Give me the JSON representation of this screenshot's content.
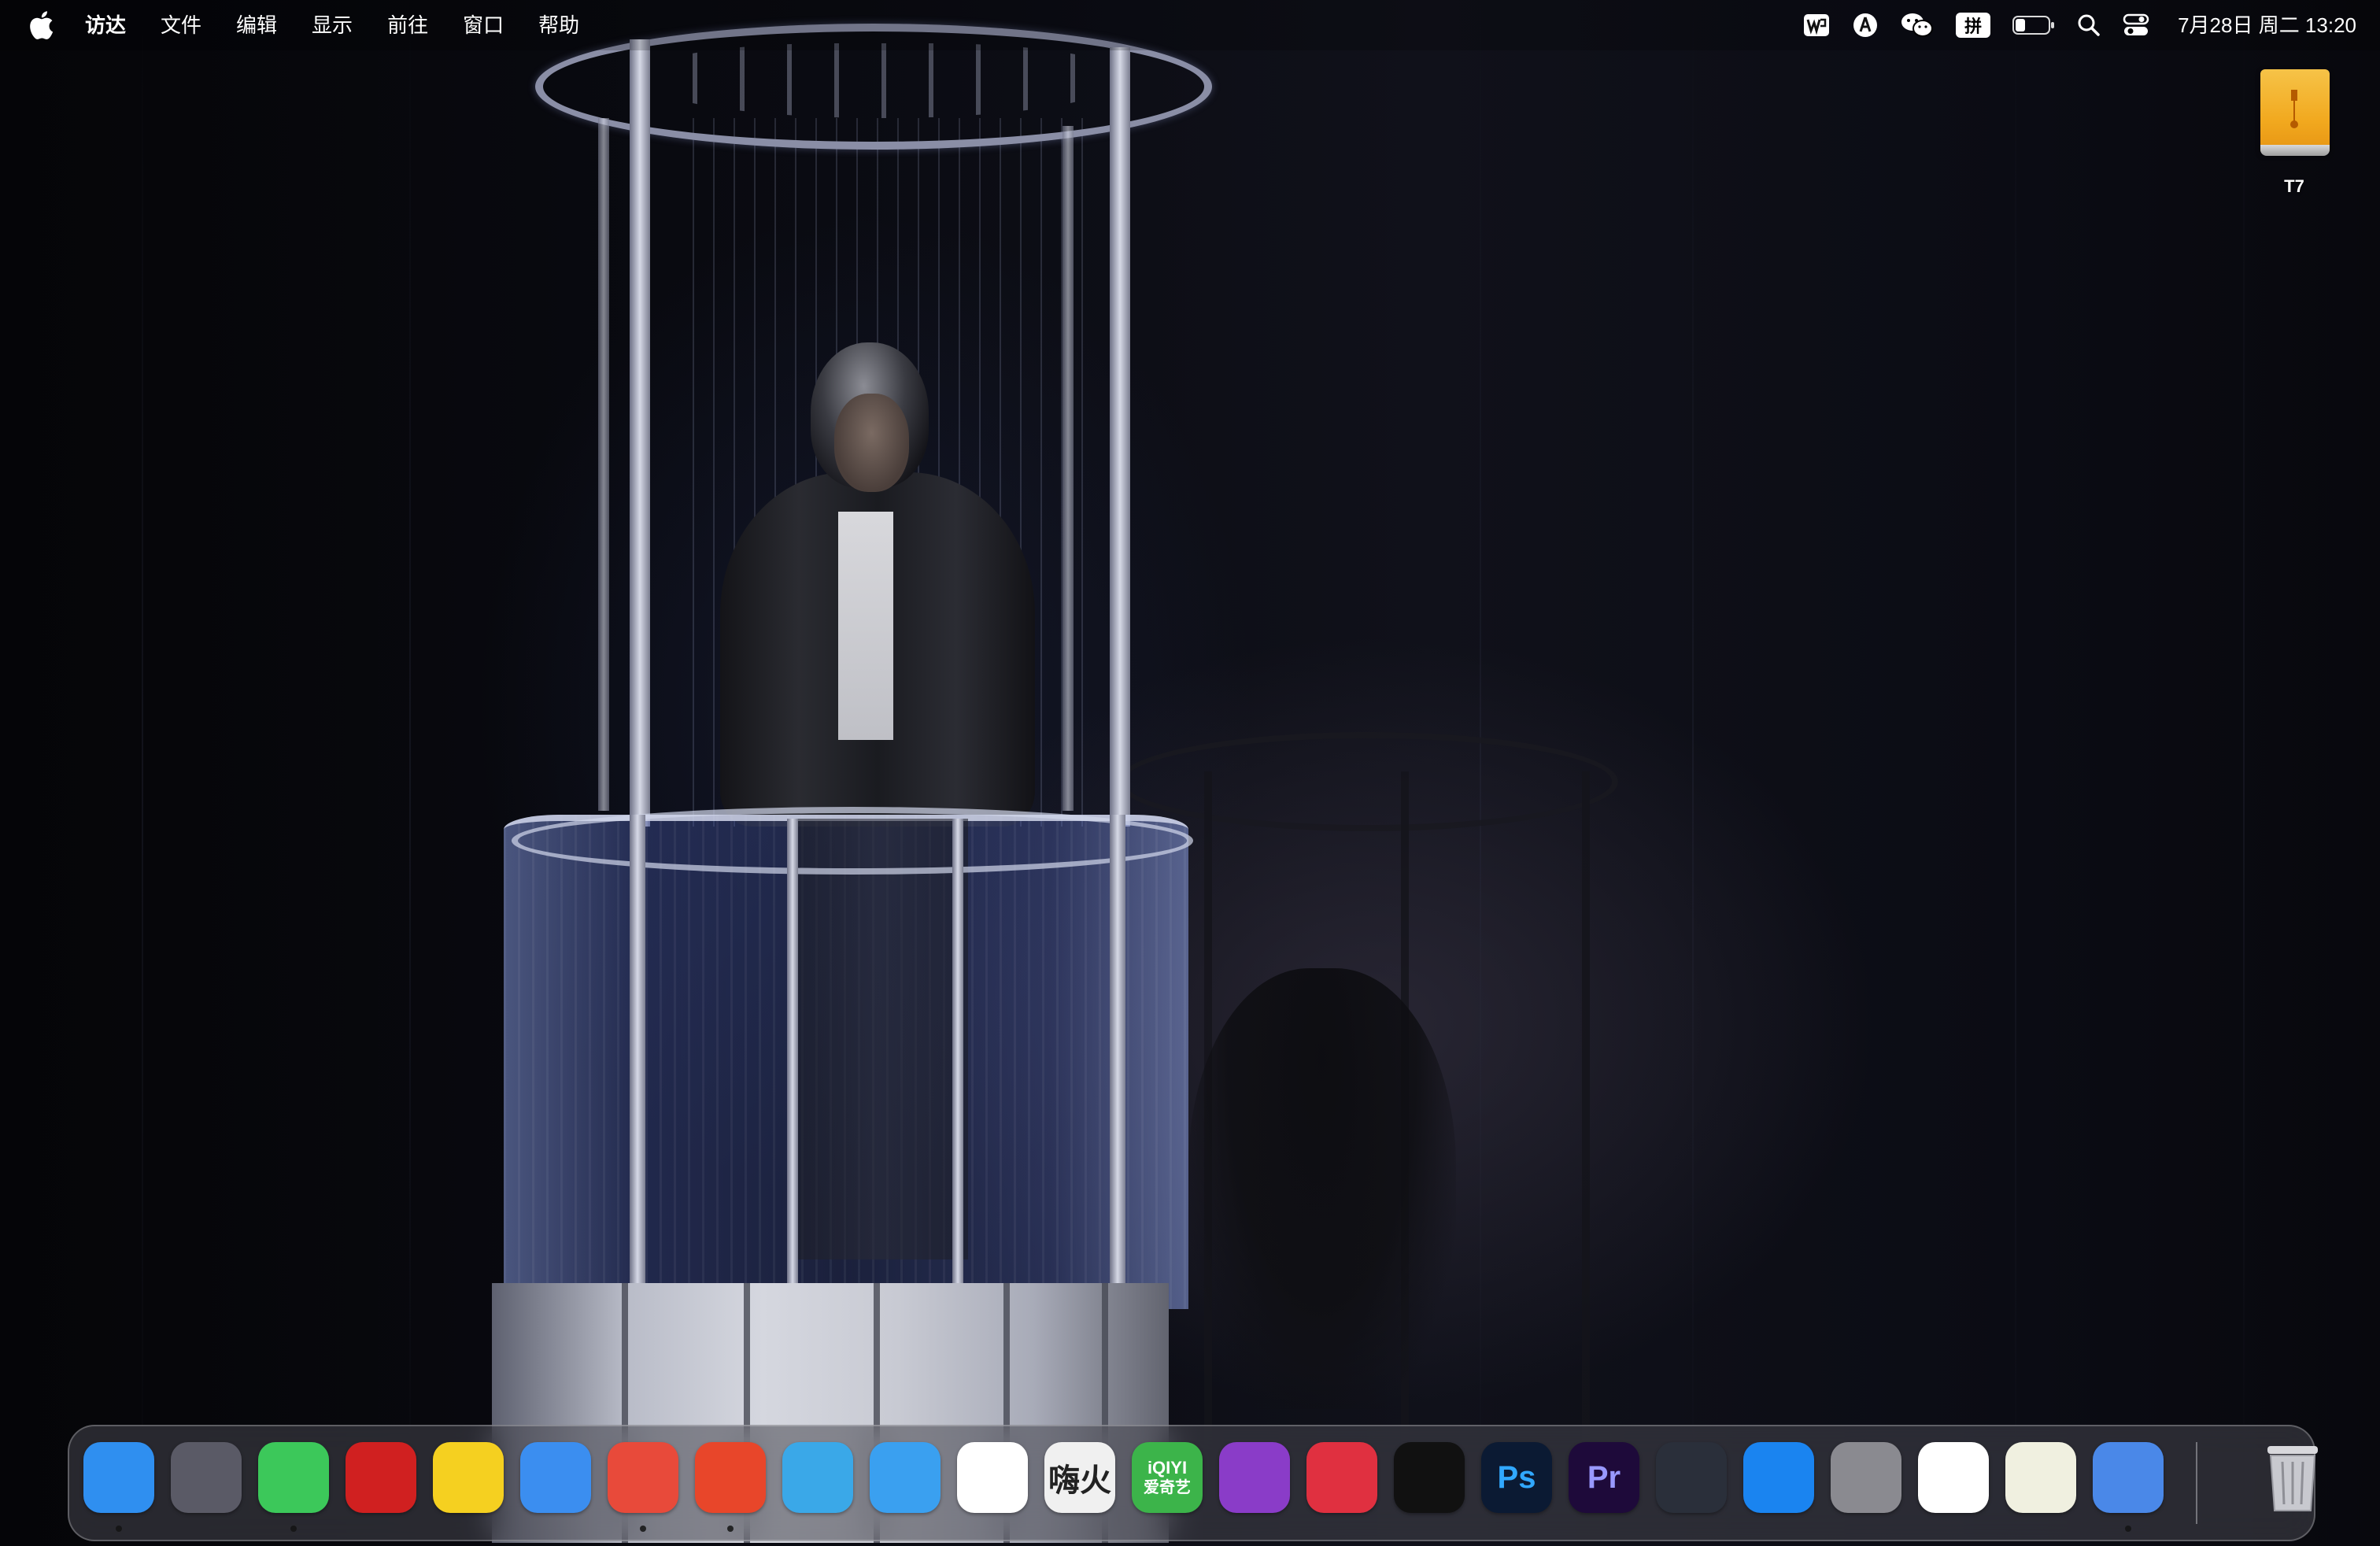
{
  "menubar": {
    "app_name": "访达",
    "menus": [
      "文件",
      "编辑",
      "显示",
      "前往",
      "窗口",
      "帮助"
    ],
    "input_method": "拼",
    "datetime": "7月28日 周二 13:20",
    "status_icons": [
      "wps-icon",
      "app-store-helper-icon",
      "wechat-icon",
      "input-method-icon",
      "battery-icon",
      "spotlight-search-icon",
      "control-center-icon"
    ],
    "battery_level": 0.3
  },
  "desktop": {
    "drive_label": "T7"
  },
  "dock": {
    "apps": [
      {
        "icon": "finder-icon",
        "color": "#2f8ff0",
        "running": true
      },
      {
        "icon": "blank-app-icon",
        "color": "#5a5a66",
        "running": false
      },
      {
        "icon": "messages-icon",
        "color": "#3cc85a",
        "running": true
      },
      {
        "icon": "mask-app-icon",
        "color": "#d02020",
        "running": false
      },
      {
        "icon": "notes-yellow-icon",
        "color": "#f5d020",
        "running": false
      },
      {
        "icon": "cloud-app-icon",
        "color": "#3b8ef0",
        "running": false
      },
      {
        "icon": "chrome-icon",
        "color": "#e84a3a",
        "running": true
      },
      {
        "icon": "red-app-icon",
        "color": "#e8462a",
        "running": true
      },
      {
        "icon": "pink-blue-app-icon",
        "color": "#3aa8e8",
        "running": false
      },
      {
        "icon": "bird-app-icon",
        "color": "#3aa0f0",
        "running": false
      },
      {
        "icon": "video-player-icon",
        "color": "#ffffff",
        "running": false
      },
      {
        "icon": "huohuo-player-icon",
        "color": "#f0f0f0",
        "label": "嗨火",
        "running": false
      },
      {
        "icon": "iqiyi-icon",
        "color": "#3cb44a",
        "label_top": "iQIYI",
        "label_bottom": "爱奇艺",
        "running": false
      },
      {
        "icon": "downloader-icon",
        "color": "#8a3cc8",
        "running": false
      },
      {
        "icon": "heart-rate-app-icon",
        "color": "#e03040",
        "running": false
      },
      {
        "icon": "capcut-icon",
        "color": "#111111",
        "running": false
      },
      {
        "icon": "photoshop-icon",
        "color": "#0b1a33",
        "label": "Ps",
        "running": false
      },
      {
        "icon": "premiere-icon",
        "color": "#1e0a3a",
        "label": "Pr",
        "running": false
      },
      {
        "icon": "davinci-resolve-icon",
        "color": "#2a2f3a",
        "running": false
      },
      {
        "icon": "app-store-icon",
        "color": "#1a84f0",
        "running": false
      },
      {
        "icon": "system-settings-icon",
        "color": "#8a8a90",
        "running": false
      },
      {
        "icon": "notes-icon",
        "color": "#ffffff",
        "running": false
      },
      {
        "icon": "stickies-icon",
        "color": "#f0f0e0",
        "running": false
      },
      {
        "icon": "preview-scanner-icon",
        "color": "#4a88e8",
        "running": true
      }
    ],
    "trash": {
      "icon": "trash-icon"
    }
  }
}
